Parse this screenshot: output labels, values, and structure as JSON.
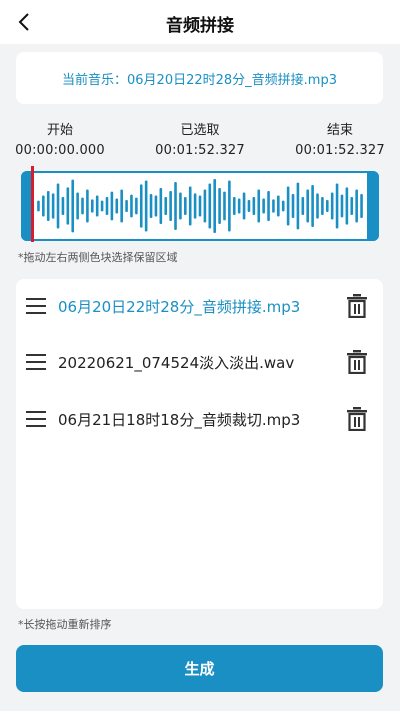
{
  "header": {
    "title": "音频拼接",
    "back_icon": "chevron-left-icon"
  },
  "current": {
    "text": "当前音乐：06月20日22时28分_音频拼接.mp3"
  },
  "times": {
    "start": {
      "label": "开始",
      "value": "00:00:00.000"
    },
    "selected": {
      "label": "已选取",
      "value": "00:01:52.327"
    },
    "end": {
      "label": "结束",
      "value": "00:01:52.327"
    }
  },
  "waveform": {
    "levels": [
      0.18,
      0.35,
      0.5,
      0.42,
      0.75,
      0.3,
      0.62,
      0.88,
      0.45,
      0.28,
      0.55,
      0.22,
      0.35,
      0.18,
      0.3,
      0.48,
      0.25,
      0.55,
      0.2,
      0.38,
      0.28,
      0.72,
      0.85,
      0.4,
      0.35,
      0.6,
      0.3,
      0.5,
      0.8,
      0.45,
      0.3,
      0.65,
      0.42,
      0.35,
      0.55,
      0.75,
      0.9,
      0.6,
      0.48,
      0.85,
      0.3,
      0.25,
      0.45,
      0.2,
      0.3,
      0.55,
      0.25,
      0.5,
      0.22,
      0.35,
      0.18,
      0.65,
      0.4,
      0.78,
      0.3,
      0.55,
      0.7,
      0.42,
      0.3,
      0.2,
      0.45,
      0.75,
      0.38,
      0.62,
      0.3,
      0.55,
      0.4
    ],
    "accent": "#1a8fc4",
    "playhead_color": "#d81e2c"
  },
  "hints": {
    "trim": "*拖动左右两侧色块选择保留区域",
    "reorder": "*长按拖动重新排序"
  },
  "tracks": [
    {
      "name": "06月20日22时28分_音频拼接.mp3",
      "active": true
    },
    {
      "name": "20220621_074524淡入淡出.wav",
      "active": false
    },
    {
      "name": "06月21日18时18分_音频裁切.mp3",
      "active": false
    }
  ],
  "generate": {
    "label": "生成"
  },
  "colors": {
    "accent": "#1a8fc4",
    "background": "#f2f3f5"
  }
}
